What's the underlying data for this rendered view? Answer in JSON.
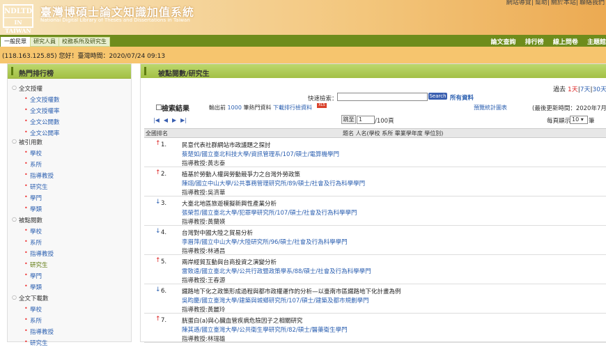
{
  "header": {
    "logo_line1": "NDLTD",
    "logo_line2": "IN TAIWAN",
    "title": "臺灣博碩士論文知識加值系統",
    "subtitle": "National Digital Library of Theses and Dissertations in Taiwan",
    "top_links": [
      "網站導覽",
      "幫助",
      "關於本站",
      "聯絡我們"
    ]
  },
  "tabs": [
    "一般民眾",
    "研究人員",
    "校務系所及研究生"
  ],
  "main_nav": [
    "論文查詢",
    "排行榜",
    "線上問卷",
    "主題館"
  ],
  "ipbar": "(118.163.125.85) 您好！臺灣時間：2020/07/24 09:13",
  "left_panel": {
    "title": "熱門排行榜",
    "groups": [
      {
        "label": "全文授權",
        "items": [
          "全文授權數",
          "全文授權率",
          "全文公開數",
          "全文公開率"
        ]
      },
      {
        "label": "被引用數",
        "items": [
          "學校",
          "系所",
          "指導教授",
          "研究生",
          "學門",
          "學類"
        ]
      },
      {
        "label": "被點閱數",
        "items": [
          "學校",
          "系所",
          "指導教授",
          "研究生",
          "學門",
          "學類"
        ]
      },
      {
        "label": "全文下載數",
        "items": [
          "學校",
          "系所",
          "指導教授",
          "研究生"
        ]
      }
    ]
  },
  "right_panel": {
    "title": "被點閱數/研究生",
    "past_week_prefix": "過去",
    "period_1day": "1天",
    "period_7day": "7天",
    "period_30day": "30天",
    "quick_search_label": "快速檢索：",
    "search_button": "Search",
    "search_all": "所有資料",
    "results_label": "檢索結果",
    "output_prefix": "輸出前",
    "output_count": "1000",
    "output_suffix": "筆熱門資料",
    "download_link": "下載排行檢資料",
    "xls_badge": "XLS",
    "stat_link": "預覽統計圖表",
    "last_update": "(最後更新時間：2020年7月23",
    "pager_arrows": [
      "|◀",
      "◀",
      "▶",
      "▶|"
    ],
    "jump_label": "跳至",
    "jump_value": "1",
    "jump_total": "/100頁",
    "per_page_label": "每頁顯示",
    "per_page_value": "10 ▾",
    "per_page_unit": "筆",
    "col_rank": "全國排名",
    "col_info": "題名 人名(學校 系所 畢業學年度 學位別)"
  },
  "rows": [
    {
      "rank": "1.",
      "dir": "up",
      "title": "民意代表社群網站市政議題之探討",
      "author": "蔡楚如/國立臺北科技大學/資訊管理系/107/碩士/電算機學門",
      "advisor": "指導教授:黃志泰"
    },
    {
      "rank": "2.",
      "dir": "up",
      "title": "植基於勞動人權與勞動競爭力之台灣外勞政策",
      "author": "陳翊/國立中山大學/公共事務管理研究所/89/碩士/社會及行為科學學門",
      "advisor": "指導教授:吳濟華"
    },
    {
      "rank": "3.",
      "dir": "down",
      "title": "大臺北地區旅遊模擬新興性產業分析",
      "author": "張榮哲/國立臺北大學/犯罪學研究所/107/碩士/社會及行為科學學門",
      "advisor": "指導教授:黃蘭媖"
    },
    {
      "rank": "4.",
      "dir": "down",
      "title": "台灣對中國大陸之貿易分析",
      "author": "李眉萍/國立中山大學/大陸研究所/96/碩士/社會及行為科學學門",
      "advisor": "指導教授:林通昌"
    },
    {
      "rank": "5.",
      "dir": "up",
      "title": "兩岸經貿互動與台商投資之演變分析",
      "author": "雷致遠/國立臺北大學/公共行政暨政策學系/88/碩士/社會及行為科學學門",
      "advisor": "指導教授:王春源"
    },
    {
      "rank": "6.",
      "dir": "down",
      "title": "鐵路地下化之政策形成過程與都市政權運作的分析—以臺南市區鐵路地下化計畫為例",
      "author": "吳昀慶/國立臺灣大學/建築與城鄉研究所/107/碩士/建築及都市規劃學門",
      "advisor": "指導教授:黃麗玲"
    },
    {
      "rank": "7.",
      "dir": "up",
      "title": "胱蛋白(a)與心臟血管疾病危險因子之相關研究",
      "author": "陳其遜/國立臺灣大學/公共衛生學研究所/82/碩士/醫藥衛生學門",
      "advisor": "指導教授:林瑞雄"
    }
  ]
}
